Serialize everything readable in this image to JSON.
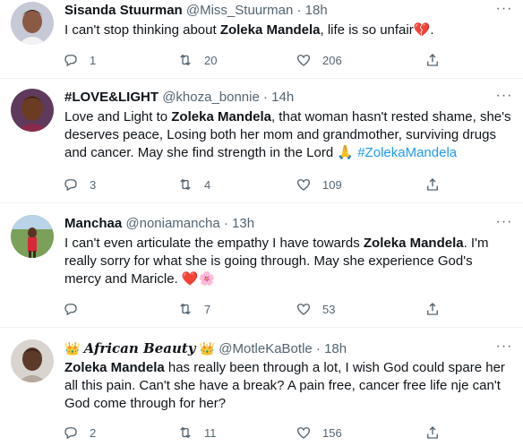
{
  "tweets": [
    {
      "name": "Sisanda Stuurman",
      "handle": "@Miss_Stuurman",
      "sep": "·",
      "time": "18h",
      "text_pre": "I can't stop thinking about ",
      "text_bold": "Zoleka Mandela",
      "text_post": ", life is so unfair",
      "emoji": "💔",
      "text_end": ".",
      "replies": "1",
      "retweets": "20",
      "likes": "206"
    },
    {
      "name": "#LOVE&LIGHT",
      "handle": "@khoza_bonnie",
      "sep": "·",
      "time": "14h",
      "text_pre": "Love and Light to ",
      "text_bold": "Zoleka Mandela",
      "text_post": ", that woman hasn't rested shame, she's deserves peace, Losing both her mom and grandmother, surviving drugs and cancer. May she find strength in the Lord ",
      "emoji": "🙏",
      "hashtag": "#ZolekaMandela",
      "replies": "3",
      "retweets": "4",
      "likes": "109"
    },
    {
      "name": "Manchaa",
      "handle": "@noniamancha",
      "sep": "·",
      "time": "13h",
      "text_pre": "I can't even articulate the empathy I have towards ",
      "text_bold": "Zoleka Mandela",
      "text_post": ". I'm really sorry for what she is going through. May she experience God's mercy and Maricle. ",
      "emoji": "❤️🌸",
      "replies": "",
      "retweets": "7",
      "likes": "53"
    },
    {
      "name_crown_left": "👑",
      "name": "African Beauty",
      "name_crown_right": "👑",
      "handle": "@MotleKaBotle",
      "sep": "·",
      "time": "18h",
      "text_bold": "Zoleka Mandela",
      "text_post": " has really been through a lot, I wish God could spare her all this pain. Can't she have a break? A pain free, cancer free life nje can't God come through for her?",
      "replies": "2",
      "retweets": "11",
      "likes": "156"
    }
  ],
  "icons": {
    "reply": "reply-icon",
    "retweet": "retweet-icon",
    "like": "like-icon",
    "share": "share-icon",
    "more": "more-icon"
  },
  "colors": {
    "text": "#0f1419",
    "secondary": "#536471",
    "hashtag": "#1d9bf0",
    "divider": "#eff3f4",
    "heart": "#e0245e"
  }
}
